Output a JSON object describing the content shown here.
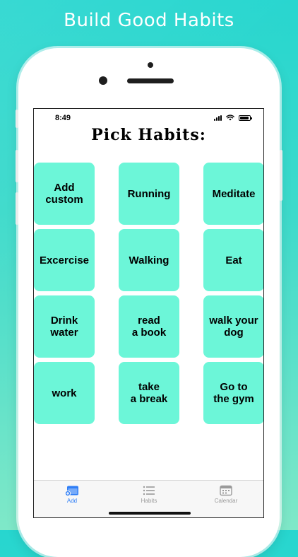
{
  "promo": {
    "title": "Build Good Habits"
  },
  "status_bar": {
    "time": "8:49",
    "battery_level": 0.9
  },
  "page": {
    "title": "Pick Habits:"
  },
  "habits": [
    {
      "label": "Add\ncustom"
    },
    {
      "label": "Running"
    },
    {
      "label": "Meditate"
    },
    {
      "label": "Excercise"
    },
    {
      "label": "Walking"
    },
    {
      "label": "Eat"
    },
    {
      "label": "Drink\nwater"
    },
    {
      "label": "read\na book"
    },
    {
      "label": "walk your\ndog"
    },
    {
      "label": "work"
    },
    {
      "label": "take\na break"
    },
    {
      "label": "Go to\nthe gym"
    }
  ],
  "tabs": [
    {
      "label": "Add",
      "icon": "calendar-add-icon",
      "active": true
    },
    {
      "label": "Habits",
      "icon": "list-icon",
      "active": false
    },
    {
      "label": "Calendar",
      "icon": "calendar-icon",
      "active": false
    }
  ],
  "colors": {
    "card": "#6cf6d8",
    "accent": "#2f7ef6",
    "tab_inactive": "#9a9a9a",
    "background_top": "#27d6cf",
    "background_bottom": "#7fe8c8"
  }
}
